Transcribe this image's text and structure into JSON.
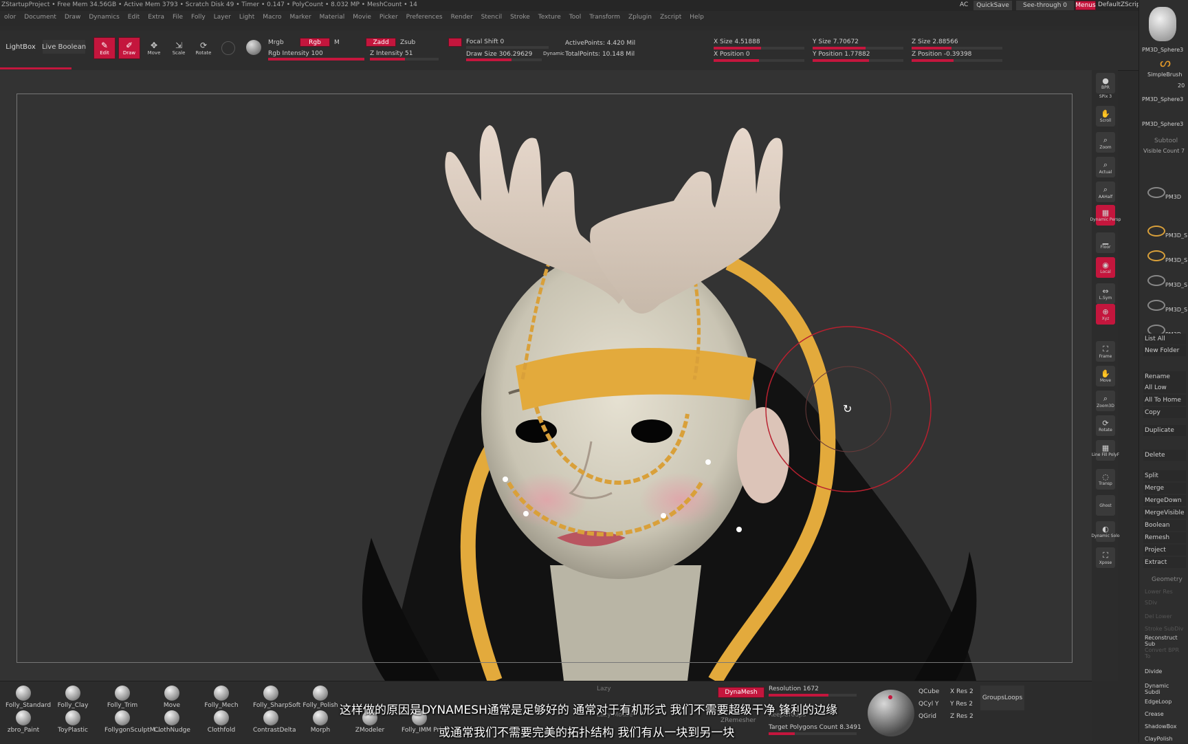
{
  "app": {
    "title_bar": "ZStartupProject  • Free Mem 34.56GB • Active Mem 3793 • Scratch Disk 49 • Timer • 0.147 • PolyCount • 8.032 MP • MeshCount • 14",
    "ac": "AC",
    "quicksave": "QuickSave",
    "seethrough": "See-through  0",
    "menus": "Menus",
    "script": "DefaultZScript"
  },
  "menubar": [
    "olor",
    "Document",
    "Draw",
    "Dynamics",
    "Edit",
    "Extra",
    "File",
    "Folly",
    "Layer",
    "Light",
    "Macro",
    "Marker",
    "Material",
    "Movie",
    "Picker",
    "Preferences",
    "Render",
    "Stencil",
    "Stroke",
    "Texture",
    "Tool",
    "Transform",
    "Zplugin",
    "Zscript",
    "Help"
  ],
  "toolbar": {
    "lightbox": "LightBox",
    "live_boolean": "Live Boolean",
    "edit": "Edit",
    "draw": "Draw",
    "move": "Move",
    "scale": "Scale",
    "rotate": "Rotate",
    "mrgb": "Mrgb",
    "rgb": "Rgb",
    "m": "M",
    "zadd": "Zadd",
    "zsub": "Zsub",
    "rgb_intensity": "Rgb Intensity 100",
    "z_intensity": "Z Intensity 51",
    "focal_shift": "Focal Shift 0",
    "draw_size": "Draw Size 306.29629",
    "dynamic": "Dynamic",
    "active_points": "ActivePoints: 4.420 Mil",
    "total_points": "TotalPoints: 10.148 Mil",
    "x_size": "X Size 4.51888",
    "y_size": "Y Size 7.70672",
    "z_size": "Z Size 2.88566",
    "x_position": "X Position 0",
    "y_position": "Y Position 1.77882",
    "z_position": "Z Position -0.39398",
    "rgb_intensity_level": 1.0,
    "z_intensity_level": 0.51
  },
  "dock": [
    {
      "label": "BPR",
      "icon": "sphere-icon"
    },
    {
      "label": "SPix 3",
      "icon": ""
    },
    {
      "label": "Scroll",
      "icon": "hand-icon"
    },
    {
      "label": "Zoom",
      "icon": "magnifier-icon"
    },
    {
      "label": "Actual",
      "icon": "magnifier-icon"
    },
    {
      "label": "AAHalf",
      "icon": "magnifier-icon"
    },
    {
      "label": "Dynamic Persp",
      "icon": "grid-icon"
    },
    {
      "label": "Floor",
      "icon": "floor-icon"
    },
    {
      "label": "Local",
      "icon": "local-icon"
    },
    {
      "label": "L.Sym",
      "icon": "sym-icon"
    },
    {
      "label": "Xyz",
      "icon": "xyz-icon"
    },
    {
      "label": "Frame",
      "icon": "frame-icon"
    },
    {
      "label": "Move",
      "icon": "hand-icon"
    },
    {
      "label": "Zoom3D",
      "icon": "magnifier-icon"
    },
    {
      "label": "Rotate",
      "icon": "rotate-icon"
    },
    {
      "label": "Line Fill PolyF",
      "icon": "polyframe-icon"
    },
    {
      "label": "Transp",
      "icon": "transp-icon"
    },
    {
      "label": "Ghost",
      "icon": ""
    },
    {
      "label": "Dynamic Solo",
      "icon": "solo-icon"
    },
    {
      "label": "Xpose",
      "icon": "xpose-icon"
    }
  ],
  "right_panel": {
    "thumbs": [
      "PM3D_Sphere3",
      "SimpleBrush",
      "20",
      "PM3D_Sphere3",
      "PM3D_Sphere3"
    ],
    "subtool_header": "Subtool",
    "visible_count": "Visible Count 7",
    "subtools": [
      "PM3D",
      "PM3D_S",
      "PM3D_S",
      "PM3D_S",
      "PM3D_S",
      "PM3D_"
    ],
    "actions": [
      "List All",
      "New Folder",
      "Rename",
      "All Low",
      "All To Home",
      "Copy",
      "Duplicate",
      "Delete",
      "Split",
      "Merge",
      "MergeDown",
      "MergeVisible",
      "Boolean",
      "Remesh",
      "Project",
      "Extract"
    ],
    "geometry_header": "Geometry",
    "geometry": [
      "Lower Res",
      "SDiv",
      "Del Lower",
      "Stroke SubDiv",
      "Reconstruct Sub",
      "Convert BPR To",
      "Divide",
      "Dynamic Subdi",
      "EdgeLoop",
      "Crease",
      "ShadowBox",
      "ClayPolish"
    ]
  },
  "brushes": [
    {
      "label": "Folly_Standard"
    },
    {
      "label": "Folly_Clay"
    },
    {
      "label": "Folly_Trim"
    },
    {
      "label": "Move"
    },
    {
      "label": "Folly_Mech"
    },
    {
      "label": "Folly_SharpSoft"
    },
    {
      "label": "Folly_Polish"
    },
    {
      "label": "zbro_Paint"
    },
    {
      "label": "ToyPlastic"
    },
    {
      "label": "FollygonSculptM…"
    },
    {
      "label": "ClothNudge"
    },
    {
      "label": "Clothfold"
    },
    {
      "label": "ContrastDelta"
    },
    {
      "label": "Morph"
    },
    {
      "label": "ZModeler"
    },
    {
      "label": "Folly_IMM Pri"
    }
  ],
  "bottom_right": {
    "dynamesh": "DynaMesh",
    "resolution": "Resolution 1672",
    "keep_groups": "KeepGroups",
    "zremesher": "ZRemesher",
    "target_polygons": "Target Polygons Count 8.3491",
    "qcube": "QCube",
    "qcyl_y": "QCyl Y",
    "qgrid": "QGrid",
    "x_res": "X Res 2",
    "y_res": "Y Res 2",
    "z_res": "Z Res 2",
    "groups_loops": "GroupsLoops",
    "lazy": "Lazy",
    "lazy_mouse": "Lazy Mouse"
  },
  "subtitles": {
    "line1": "这样做的原因是DYNAMESH通常是足够好的  通常对于有机形式  我们不需要超级干净  锋利的边缘",
    "line2": "或通常我们不需要完美的拓扑结构  我们有从一块到另一块"
  },
  "colors": {
    "accent": "#c4163d",
    "gold": "#e3aa3c",
    "skin": "#d9d4c4"
  }
}
